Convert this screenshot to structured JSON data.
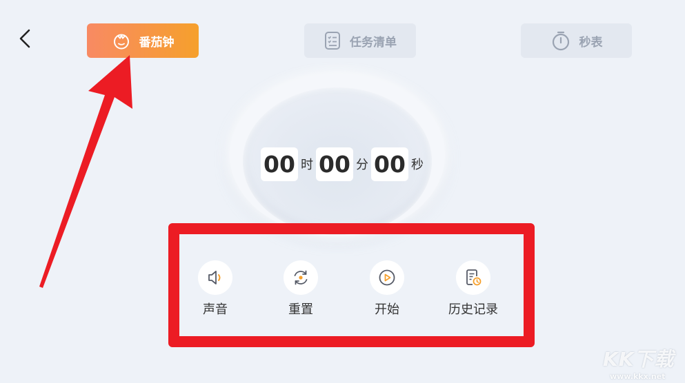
{
  "colors": {
    "accent_start": "#f88a63",
    "accent_end": "#f6a02c",
    "highlight_red": "#ec1c24",
    "background": "#eef2f8"
  },
  "header": {
    "back_icon": "chevron-left-icon",
    "tabs": [
      {
        "label": "番茄钟",
        "icon": "tomato-icon",
        "active": true
      },
      {
        "label": "任务清单",
        "icon": "checklist-icon",
        "active": false
      },
      {
        "label": "秒表",
        "icon": "stopwatch-icon",
        "active": false
      }
    ]
  },
  "timer": {
    "hours": "00",
    "hours_unit": "时",
    "minutes": "00",
    "minutes_unit": "分",
    "seconds": "00",
    "seconds_unit": "秒"
  },
  "controls": [
    {
      "label": "声音",
      "icon": "speaker-icon"
    },
    {
      "label": "重置",
      "icon": "reset-icon"
    },
    {
      "label": "开始",
      "icon": "play-icon"
    },
    {
      "label": "历史记录",
      "icon": "history-icon"
    }
  ],
  "watermark": {
    "logo": "KK下载",
    "url": "www.kkx.net"
  }
}
